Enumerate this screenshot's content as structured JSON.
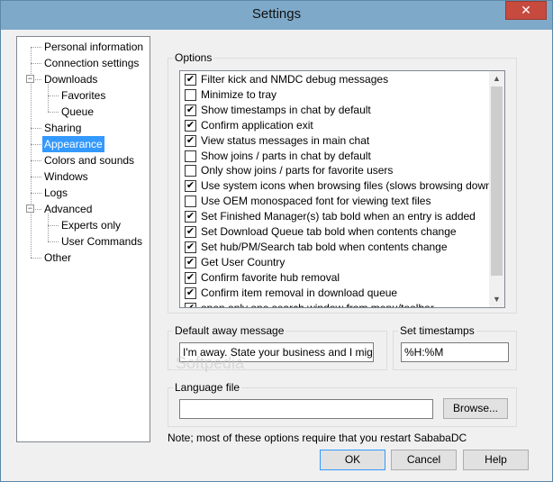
{
  "window": {
    "title": "Settings",
    "close_glyph": "✕"
  },
  "tree": {
    "items": [
      {
        "label": "Personal information",
        "level": 0
      },
      {
        "label": "Connection settings",
        "level": 0
      },
      {
        "label": "Downloads",
        "level": 0,
        "expander": "−"
      },
      {
        "label": "Favorites",
        "level": 1
      },
      {
        "label": "Queue",
        "level": 1
      },
      {
        "label": "Sharing",
        "level": 0
      },
      {
        "label": "Appearance",
        "level": 0,
        "selected": true
      },
      {
        "label": "Colors and sounds",
        "level": 0
      },
      {
        "label": "Windows",
        "level": 0
      },
      {
        "label": "Logs",
        "level": 0
      },
      {
        "label": "Advanced",
        "level": 0,
        "expander": "−"
      },
      {
        "label": "Experts only",
        "level": 1
      },
      {
        "label": "User Commands",
        "level": 1
      },
      {
        "label": "Other",
        "level": 0
      }
    ]
  },
  "options": {
    "group_label": "Options",
    "items": [
      {
        "label": "Filter kick and NMDC debug messages",
        "checked": true
      },
      {
        "label": "Minimize to tray",
        "checked": false
      },
      {
        "label": "Show timestamps in chat by default",
        "checked": true
      },
      {
        "label": "Confirm application exit",
        "checked": true
      },
      {
        "label": "View status messages in main chat",
        "checked": true
      },
      {
        "label": "Show joins / parts in chat by default",
        "checked": false
      },
      {
        "label": "Only show joins / parts for favorite users",
        "checked": false
      },
      {
        "label": "Use system icons when browsing files (slows browsing down a bit)",
        "checked": true
      },
      {
        "label": "Use OEM monospaced font for viewing text files",
        "checked": false
      },
      {
        "label": "Set Finished Manager(s) tab bold when an entry is added",
        "checked": true
      },
      {
        "label": "Set Download Queue tab bold when contents change",
        "checked": true
      },
      {
        "label": "Set hub/PM/Search tab bold when contents change",
        "checked": true
      },
      {
        "label": "Get User Country",
        "checked": true
      },
      {
        "label": "Confirm favorite hub removal",
        "checked": true
      },
      {
        "label": "Confirm item removal in download queue",
        "checked": true
      },
      {
        "label": "open only one search window from menu/toolbar",
        "checked": true
      }
    ],
    "check_glyph": "✔",
    "scroll_up_glyph": "▲",
    "scroll_down_glyph": "▼"
  },
  "away": {
    "label": "Default away message",
    "value": "I'm away. State your business and I might"
  },
  "timestamps": {
    "label": "Set timestamps",
    "value": "%H:%M"
  },
  "language": {
    "label": "Language file",
    "value": "",
    "browse_label": "Browse..."
  },
  "note": "Note; most of these options require that you restart SababaDC",
  "watermark": "Softpedia",
  "buttons": {
    "ok": "OK",
    "cancel": "Cancel",
    "help": "Help"
  }
}
